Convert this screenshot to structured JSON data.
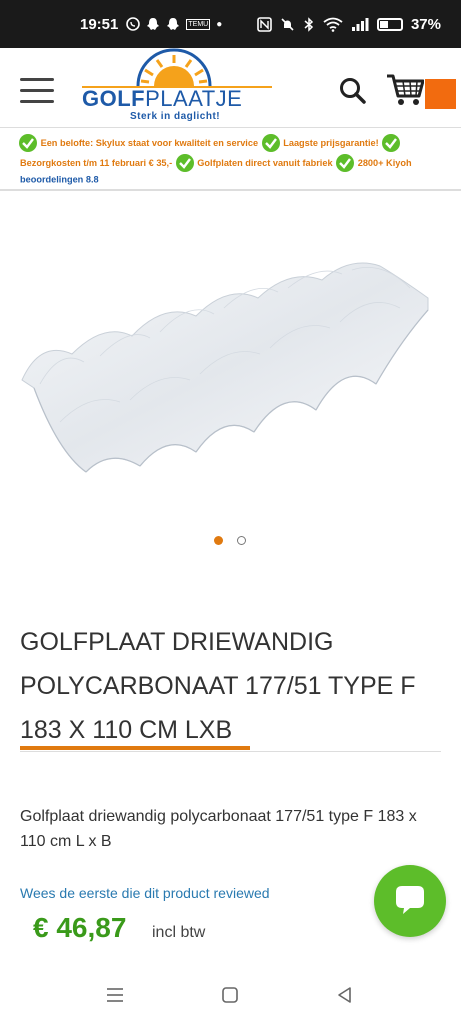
{
  "status_bar": {
    "time": "19:51",
    "temu_label": "TEMU",
    "battery_percent": "37%",
    "icons": [
      "whatsapp-icon",
      "snapchat-icon",
      "snapchat-icon",
      "temu-icon",
      "dot-icon",
      "nfc-icon",
      "mute-icon",
      "bluetooth-icon",
      "wifi-icon",
      "signal-icon",
      "battery-icon"
    ]
  },
  "header": {
    "logo": {
      "name_part1": "GOLF",
      "name_part2": "PLAATJE",
      "slogan": "Sterk in daglicht!"
    },
    "icons": [
      "menu-icon",
      "search-icon",
      "cart-icon"
    ],
    "accent_color": "#f26b0f"
  },
  "usp": {
    "item1": "Een belofte: Skylux staat voor kwaliteit en service",
    "item2": "Laagste prijsgarantie!",
    "item3": "Bezorgkosten t/m 11 februari € 35,-",
    "item4": "Golfplaten direct vanuit fabriek",
    "item5": "2800+ Kiyoh",
    "item5_cont": "beoordelingen 8.8",
    "icon": "checkmark-icon",
    "check_color": "#5dbd2a"
  },
  "carousel": {
    "slide_count": 2,
    "active_index": 0
  },
  "product": {
    "title_line1": "GOLFPLAAT DRIEWANDIG",
    "title_line2": "POLYCARBONAAT 177/51 TYPE F",
    "title_line3": "183 X 110 CM LXB",
    "description": "Golfplaat driewandig polycarbonaat 177/51 type F 183 x 110 cm L x B",
    "review_link": "Wees de eerste die dit product reviewed",
    "price": "€ 46,87",
    "vat_label": "incl btw",
    "price_color": "#3a9a1a"
  },
  "chat": {
    "icon": "chat-bubble-icon",
    "color": "#5dbd2a"
  },
  "navigation_bar": {
    "icons": [
      "recent-apps-icon",
      "home-icon",
      "back-icon"
    ]
  }
}
